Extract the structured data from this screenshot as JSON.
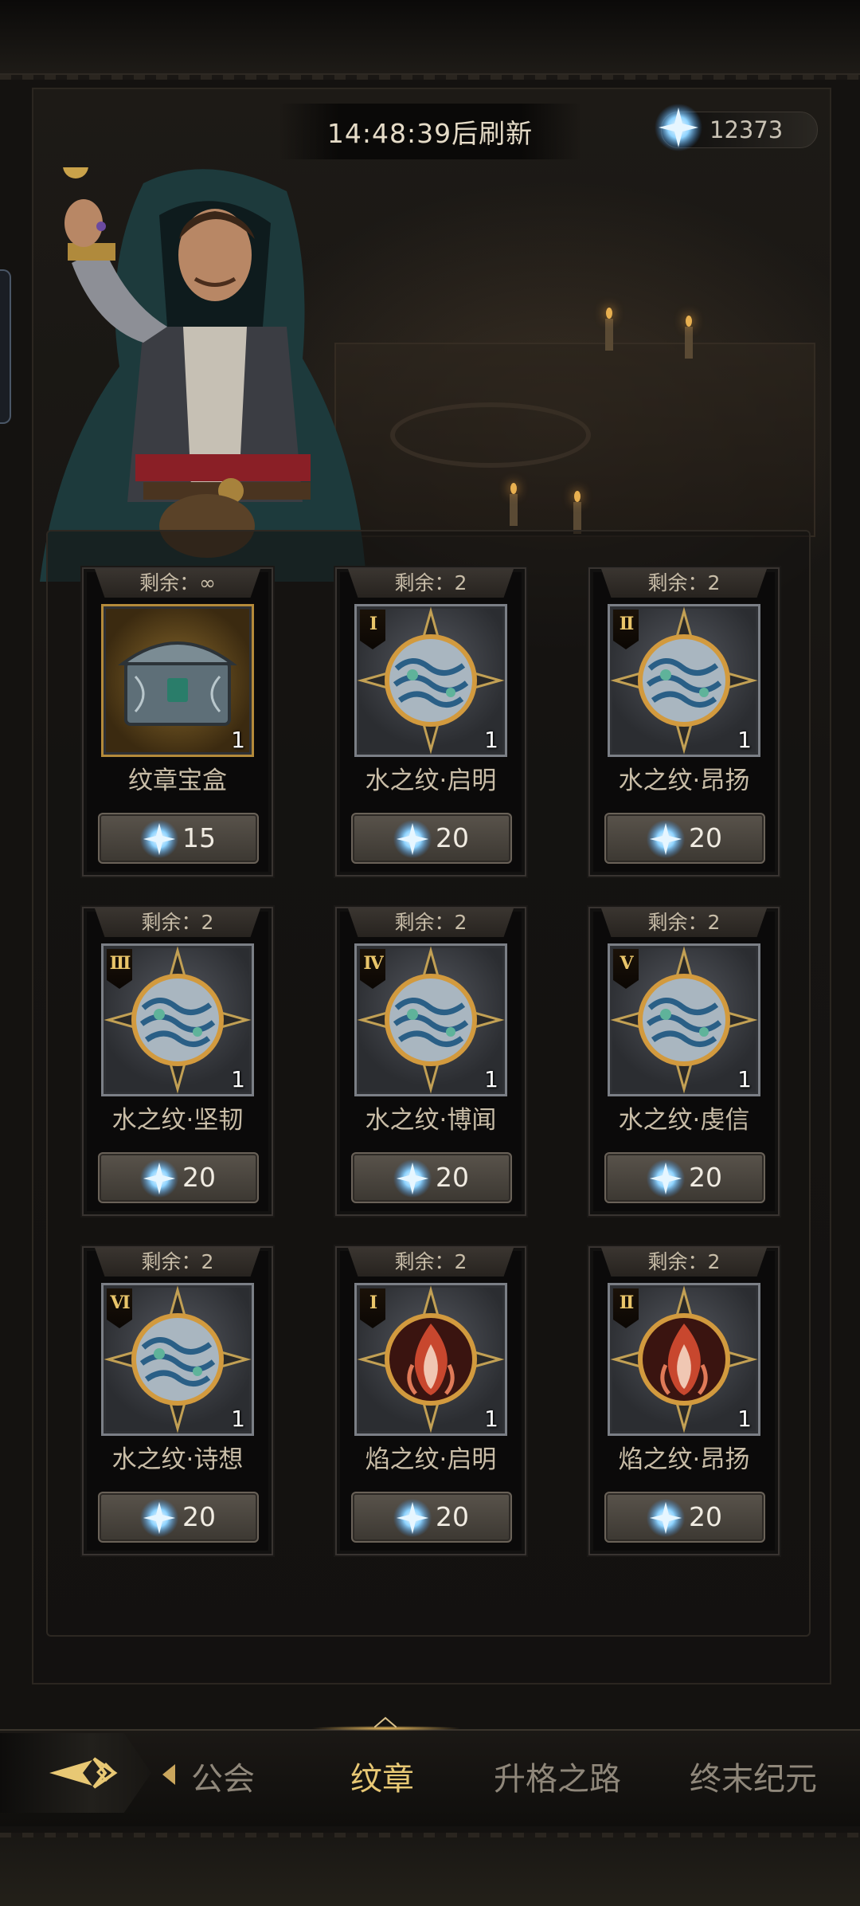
{
  "header": {
    "refresh_timer": "14:48:39后刷新",
    "currency": {
      "icon": "blue-crystal-icon",
      "amount": "12373"
    }
  },
  "shop": {
    "items": [
      {
        "stock": "剩余：∞",
        "tier": "",
        "art": "chest",
        "quantity": "1",
        "name": "纹章宝盒",
        "price": "15"
      },
      {
        "stock": "剩余：2",
        "tier": "I",
        "art": "water",
        "quantity": "1",
        "name": "水之纹·启明",
        "price": "20"
      },
      {
        "stock": "剩余：2",
        "tier": "II",
        "art": "water",
        "quantity": "1",
        "name": "水之纹·昂扬",
        "price": "20"
      },
      {
        "stock": "剩余：2",
        "tier": "III",
        "art": "water",
        "quantity": "1",
        "name": "水之纹·坚韧",
        "price": "20"
      },
      {
        "stock": "剩余：2",
        "tier": "IV",
        "art": "water",
        "quantity": "1",
        "name": "水之纹·博闻",
        "price": "20"
      },
      {
        "stock": "剩余：2",
        "tier": "V",
        "art": "water",
        "quantity": "1",
        "name": "水之纹·虔信",
        "price": "20"
      },
      {
        "stock": "剩余：2",
        "tier": "VI",
        "art": "water",
        "quantity": "1",
        "name": "水之纹·诗想",
        "price": "20"
      },
      {
        "stock": "剩余：2",
        "tier": "I",
        "art": "fire",
        "quantity": "1",
        "name": "焰之纹·启明",
        "price": "20"
      },
      {
        "stock": "剩余：2",
        "tier": "II",
        "art": "fire",
        "quantity": "1",
        "name": "焰之纹·昂扬",
        "price": "20"
      }
    ]
  },
  "nav": {
    "back_icon": "back-arrow-icon",
    "tabs": [
      {
        "label": "公会",
        "active": false
      },
      {
        "label": "纹章",
        "active": true
      },
      {
        "label": "升格之路",
        "active": false
      },
      {
        "label": "终末纪元",
        "active": false
      }
    ]
  },
  "colors": {
    "accent_gold": "#e8c874",
    "crystal_blue": "#8fd4ff",
    "fire_red": "#c8472e"
  }
}
